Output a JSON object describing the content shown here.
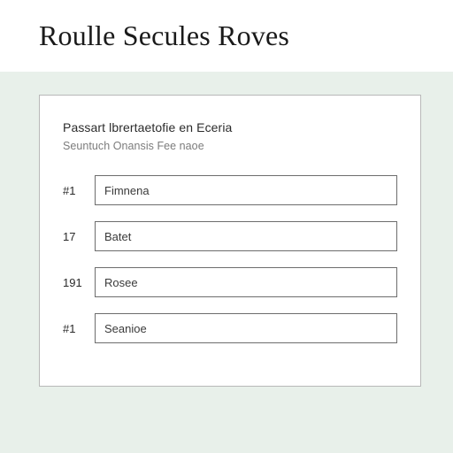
{
  "header": {
    "title": "Roulle Secules Roves"
  },
  "document": {
    "subtitle_a": "Passart lbrertaetofie en Eceria",
    "subtitle_b": "Seuntuch Onansis Fee naoe",
    "rows": [
      {
        "num": "#1",
        "value": "Fimnena"
      },
      {
        "num": "17",
        "value": "Batet"
      },
      {
        "num": "191",
        "value": "Rosee"
      },
      {
        "num": "#1",
        "value": "Seanioe"
      }
    ]
  }
}
